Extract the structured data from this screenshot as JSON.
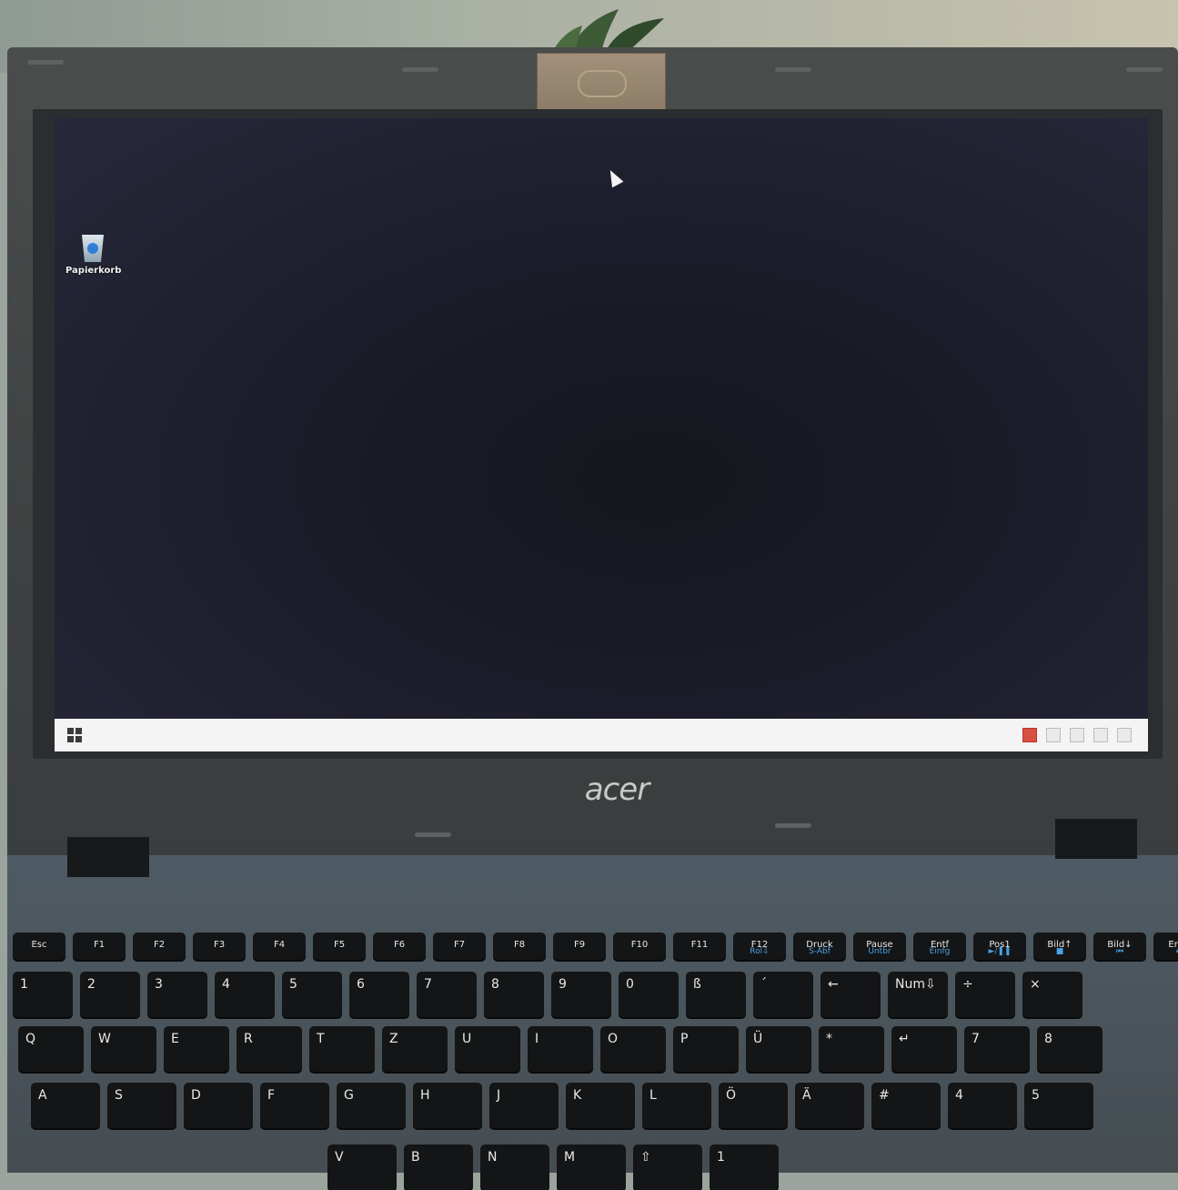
{
  "desktop": {
    "icon_label": "Papierkorb"
  },
  "brand": "acer",
  "keyboard": {
    "function_row": [
      "Esc",
      "F1",
      "F2",
      "F3",
      "F4",
      "F5",
      "F6",
      "F7",
      "F8",
      "F9",
      "F10",
      "F11",
      "F12",
      "Druck",
      "Pause",
      "Entf",
      "Pos1",
      "Bild↑",
      "Bild↓",
      "Ende"
    ],
    "function_sub": [
      "",
      "",
      "",
      "",
      "",
      "",
      "",
      "",
      "",
      "",
      "",
      "",
      "Rol⇩",
      "S-Abf",
      "Untbr",
      "Einfg",
      "►/❚❚",
      "■",
      "⏮",
      "⏭"
    ],
    "number_row": [
      "1",
      "2",
      "3",
      "4",
      "5",
      "6",
      "7",
      "8",
      "9",
      "0",
      "ß",
      "´",
      "←",
      "Num⇩",
      "÷",
      "×"
    ],
    "top_row": [
      "Q",
      "W",
      "E",
      "R",
      "T",
      "Z",
      "U",
      "I",
      "O",
      "P",
      "Ü",
      "*",
      "↵",
      "7",
      "8"
    ],
    "home_row": [
      "A",
      "S",
      "D",
      "F",
      "G",
      "H",
      "J",
      "K",
      "L",
      "Ö",
      "Ä",
      "#",
      "4",
      "5"
    ],
    "bottom_row": [
      "V",
      "B",
      "N",
      "M",
      "⇧",
      "1"
    ]
  },
  "colors": {
    "taskbar": "#f4f4f4",
    "desktop": "#1c1c2a",
    "keyboard_accent": "#4aa3e6"
  }
}
